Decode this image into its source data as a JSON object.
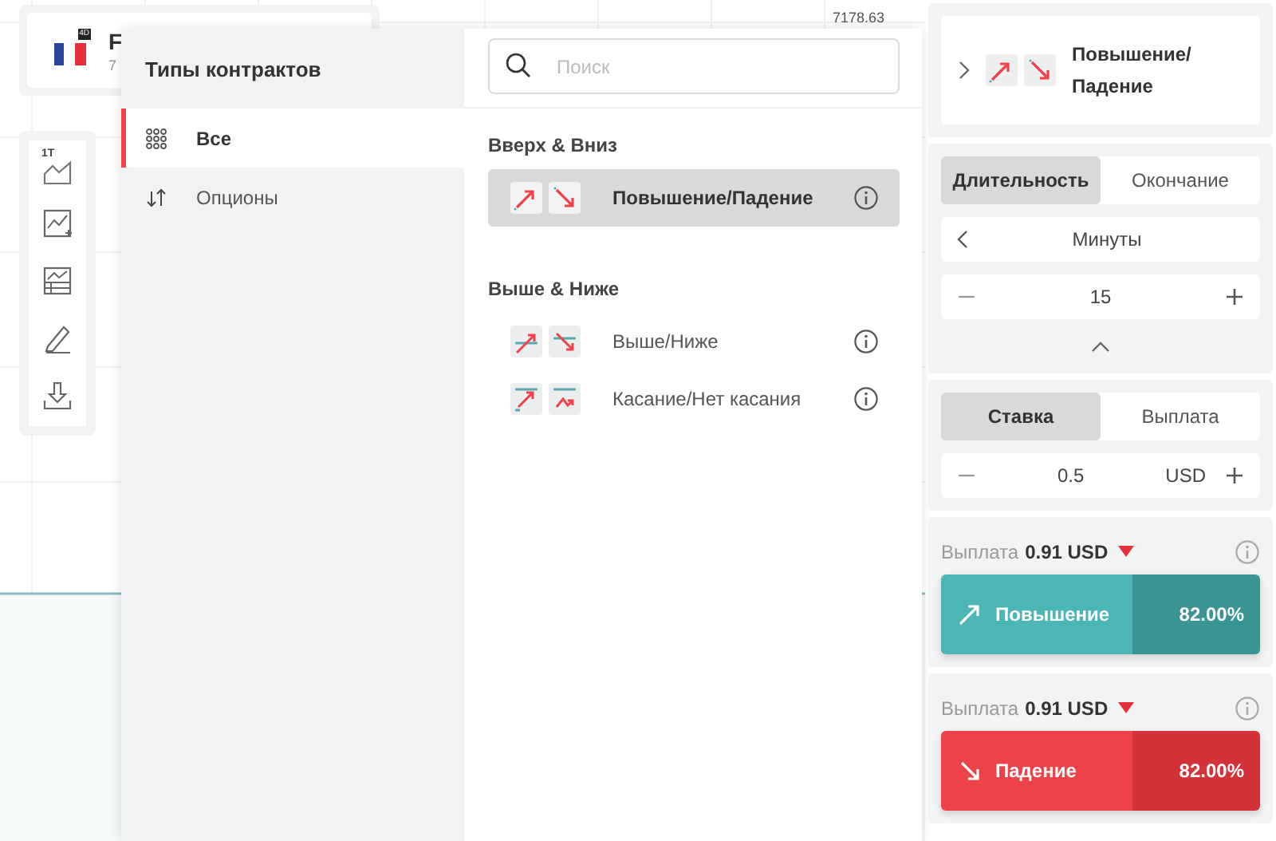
{
  "symbol": {
    "badge": "4D",
    "name": "F",
    "price": "7"
  },
  "chart": {
    "price_label": "7178.63"
  },
  "toolbar": {
    "interval": "1T"
  },
  "contract_types": {
    "title": "Типы контрактов",
    "search": {
      "placeholder": "Поиск"
    },
    "categories": [
      {
        "label": "Все",
        "kind": "all",
        "selected": true
      },
      {
        "label": "Опционы",
        "kind": "options",
        "selected": false
      }
    ],
    "groups": [
      {
        "title": "Вверх & Вниз",
        "items": [
          {
            "label": "Повышение/Падение",
            "kind": "rise_fall",
            "selected": true
          }
        ]
      },
      {
        "title": "Выше & Ниже",
        "items": [
          {
            "label": "Выше/Ниже",
            "kind": "higher_lower",
            "selected": false
          },
          {
            "label": "Касание/Нет касания",
            "kind": "touch",
            "selected": false
          }
        ]
      }
    ]
  },
  "trade": {
    "contract": {
      "label": "Повышение/Падение",
      "kind": "rise_fall"
    },
    "duration_tabs": [
      {
        "label": "Длительность",
        "selected": true
      },
      {
        "label": "Окончание",
        "selected": false
      }
    ],
    "unit": "Минуты",
    "duration": "15",
    "amount_tabs": [
      {
        "label": "Ставка",
        "selected": true
      },
      {
        "label": "Выплата",
        "selected": false
      }
    ],
    "amount": "0.5",
    "currency": "USD",
    "purchases": [
      {
        "kind": "rise",
        "payout_label": "Выплата",
        "payout": "0.91 USD",
        "label": "Повышение",
        "percent": "82.00%"
      },
      {
        "kind": "fall",
        "payout_label": "Выплата",
        "payout": "0.91 USD",
        "label": "Падение",
        "percent": "82.00%"
      }
    ]
  }
}
